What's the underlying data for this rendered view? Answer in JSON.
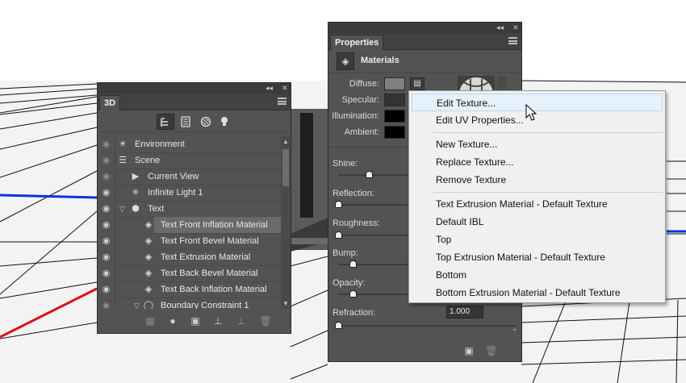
{
  "panel_3d": {
    "tab_label": "3D",
    "collapse_glyph": "◂◂",
    "close_glyph": "✕",
    "filter_icons": [
      "whole-scene-icon",
      "meshes-icon",
      "materials-icon",
      "lights-icon"
    ],
    "layers": [
      {
        "label": "Environment",
        "icon": "environment-icon",
        "visible": true,
        "dim_eye": true
      },
      {
        "label": "Scene",
        "icon": "scene-icon",
        "visible": true,
        "dim_eye": true
      },
      {
        "label": "Current View",
        "icon": "camera-icon",
        "visible": true,
        "dim_eye": true
      },
      {
        "label": "Infinite Light 1",
        "icon": "light-icon",
        "visible": true,
        "dim_eye": false
      },
      {
        "label": "Text",
        "icon": "mesh-icon",
        "visible": true,
        "dim_eye": false
      },
      {
        "label": "Text Front Inflation Material",
        "icon": "material-icon",
        "visible": true,
        "dim_eye": false,
        "selected": true
      },
      {
        "label": "Text Front Bevel Material",
        "icon": "material-icon",
        "visible": true,
        "dim_eye": false
      },
      {
        "label": "Text Extrusion Material",
        "icon": "material-icon",
        "visible": true,
        "dim_eye": false
      },
      {
        "label": "Text Back Bevel Material",
        "icon": "material-icon",
        "visible": true,
        "dim_eye": false
      },
      {
        "label": "Text Back Inflation Material",
        "icon": "material-icon",
        "visible": true,
        "dim_eye": false
      },
      {
        "label": "Boundary Constraint 1",
        "icon": "constraint-icon",
        "visible": true,
        "dim_eye": true
      }
    ],
    "bottom_icons": [
      "render-icon",
      "add-light-icon",
      "new-mesh-icon",
      "place-icon",
      "constraint-icon",
      "delete-icon"
    ]
  },
  "properties": {
    "tab_label": "Properties",
    "section_title": "Materials",
    "labels": {
      "diffuse": "Diffuse:",
      "specular": "Specular:",
      "illumination": "Illumination:",
      "ambient": "Ambient:",
      "shine": "Shine:",
      "reflection": "Reflection:",
      "roughness": "Roughness:",
      "bump": "Bump:",
      "opacity": "Opacity:",
      "refraction": "Refraction:"
    },
    "refraction_value": "1.000",
    "colors": {
      "diffuse": "#808080",
      "specular": "#333333",
      "illumination": "#000000",
      "ambient": "#000000"
    },
    "slider_levels": {
      "shine": 0.18,
      "reflection": 0.0,
      "roughness": 0.0,
      "bump": 0.09,
      "opacity": 0.09,
      "refraction": 0.0
    }
  },
  "context_menu": {
    "items": [
      {
        "label": "Edit Texture...",
        "highlighted": true
      },
      {
        "label": "Edit UV Properties..."
      },
      {
        "separator": true
      },
      {
        "label": "New Texture..."
      },
      {
        "label": "Replace Texture..."
      },
      {
        "label": "Remove Texture"
      },
      {
        "separator": true
      },
      {
        "label": "Text Extrusion Material - Default Texture"
      },
      {
        "label": "Default IBL"
      },
      {
        "label": "Top"
      },
      {
        "label": "Top Extrusion Material - Default Texture"
      },
      {
        "label": "Bottom"
      },
      {
        "label": "Bottom Extrusion Material - Default Texture"
      }
    ]
  },
  "scene_colors": {
    "x_axis": "#e01010",
    "z_axis": "#1030e0",
    "grid": "#111111",
    "floor": "#f2f2f2"
  }
}
